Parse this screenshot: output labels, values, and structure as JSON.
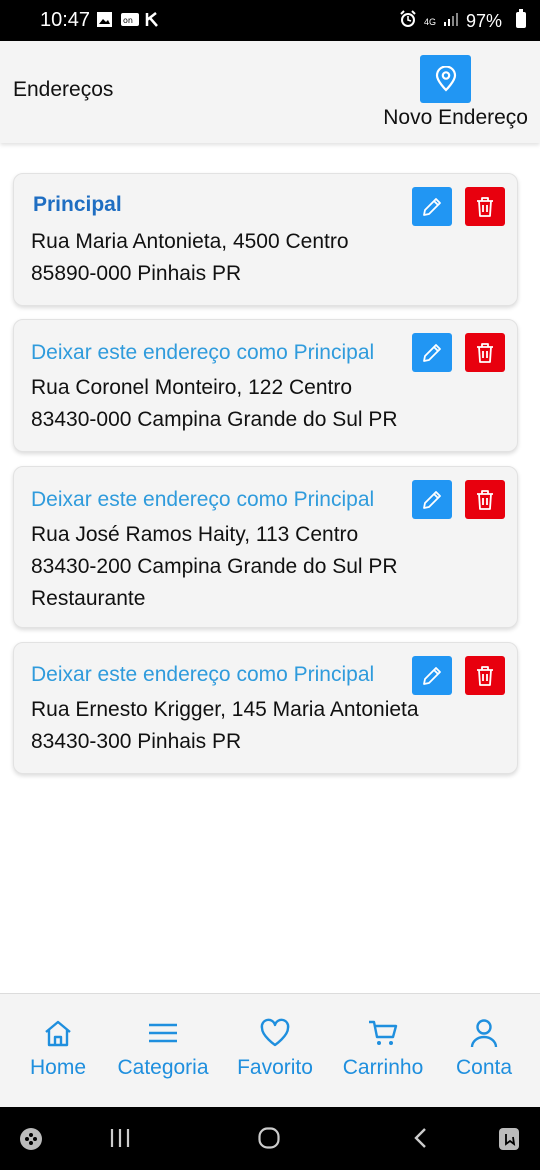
{
  "status_bar": {
    "time": "10:47",
    "network": "4G",
    "battery": "97%"
  },
  "header": {
    "title": "Endereços",
    "new_address_label": "Novo Endereço",
    "new_address_icon": "map-pin-icon"
  },
  "addresses": [
    {
      "action_label": "Principal",
      "is_principal": true,
      "line1": "Rua Maria Antonieta, 4500 Centro",
      "line2": "85890-000 Pinhais PR",
      "line3": ""
    },
    {
      "action_label": "Deixar este endereço como Principal",
      "is_principal": false,
      "line1": "Rua Coronel Monteiro, 122 Centro",
      "line2": "83430-000 Campina Grande do Sul PR",
      "line3": ""
    },
    {
      "action_label": "Deixar este endereço como Principal",
      "is_principal": false,
      "line1": "Rua José Ramos Haity, 113 Centro",
      "line2": "83430-200 Campina Grande do Sul PR",
      "line3": "Restaurante"
    },
    {
      "action_label": "Deixar este endereço como Principal",
      "is_principal": false,
      "line1": "Rua Ernesto Krigger, 145 Maria Antonieta",
      "line2": "83430-300 Pinhais PR",
      "line3": ""
    }
  ],
  "bottom_nav": [
    {
      "label": "Home",
      "icon": "home-icon"
    },
    {
      "label": "Categoria",
      "icon": "menu-icon"
    },
    {
      "label": "Favorito",
      "icon": "heart-icon"
    },
    {
      "label": "Carrinho",
      "icon": "cart-icon"
    },
    {
      "label": "Conta",
      "icon": "user-icon"
    }
  ],
  "colors": {
    "primary": "#2196f3",
    "link": "#2f9bdc",
    "principal": "#1f6ec2",
    "danger": "#e8000e",
    "nav": "#1f8fde"
  }
}
